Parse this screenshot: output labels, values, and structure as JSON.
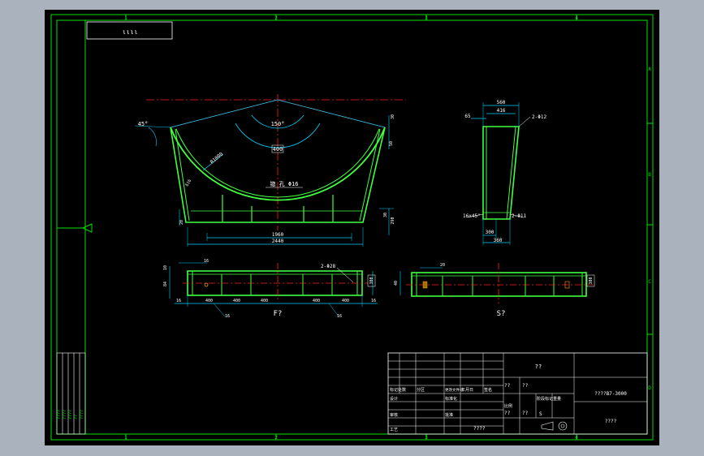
{
  "title_box": {
    "code": "ιιιι"
  },
  "zones": {
    "columns": [
      "1",
      "2",
      "3",
      "4"
    ],
    "rows": [
      "A",
      "B",
      "C",
      "D"
    ]
  },
  "main_view": {
    "angle_label": "150°",
    "chamfer_label": "45°",
    "radius_label": "R1000",
    "thickness_label": "δ16",
    "hole_note": "锪  孔  Φ16",
    "center_mark": "400",
    "dim_inner": "1960",
    "dim_outer": "2440",
    "dim_side_right": "30",
    "dim_side_right2": "50",
    "dim_height": "290",
    "dim_height_small": "20",
    "dim_left_small": "45"
  },
  "side_view": {
    "top_width": "560",
    "top_inner": "416",
    "top_left": "65",
    "slot_label": "2-Φ12",
    "chamfer_note": "16x45°",
    "hole_note2": "2-Φ11",
    "bottom_inner": "300",
    "bottom_outer": "360"
  },
  "view_f": {
    "caption": "F?",
    "dim_top_small": "16",
    "dim_top_hole": "2-Φ28",
    "dim_left": "10",
    "dim_left2": "84",
    "dim_right": "300",
    "bottom_dims": [
      "16",
      "400",
      "400",
      "400",
      "400",
      "400",
      "16"
    ],
    "under_left": "16",
    "under_right": "16"
  },
  "view_s": {
    "caption": "S?",
    "dim_top": "20",
    "dim_left": "40",
    "dim_right": "300"
  },
  "title_block": {
    "name_cell": "??",
    "drawing_no": "????B7-3000",
    "company": "????",
    "row_labels": [
      "标记处数",
      "设计",
      "审核",
      "工艺"
    ],
    "col_labels": [
      "分区",
      "更改文件号",
      "签名",
      "年月日"
    ],
    "std_label": "标准化",
    "approve_label": "批准",
    "stage_label": "阶段标记",
    "weight_label": "重量",
    "scale_label": "比例",
    "q1": "??",
    "q2": "??",
    "q3": "??",
    "q4": "??",
    "sheet_s": "S",
    "extra": "????"
  },
  "left_strip": {
    "labels": [
      "????",
      "????",
      "????",
      "??",
      "????"
    ]
  }
}
